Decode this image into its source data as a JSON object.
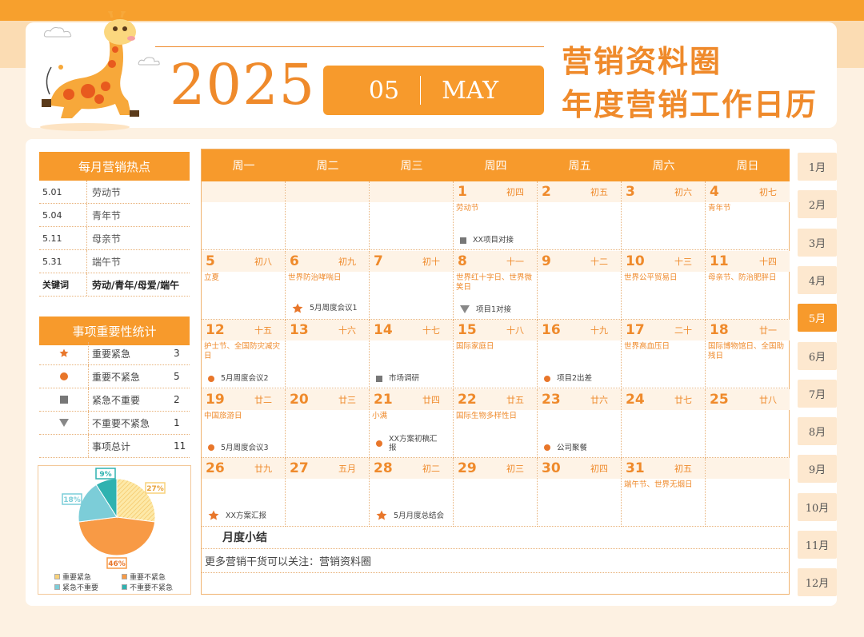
{
  "header": {
    "year": "2025",
    "month_num": "05",
    "month_en": "MAY",
    "brand": "营销资料圈",
    "subtitle": "年度营销工作日历"
  },
  "hotspots": {
    "title": "每月营销热点",
    "items": [
      {
        "date": "5.01",
        "name": "劳动节"
      },
      {
        "date": "5.04",
        "name": "青年节"
      },
      {
        "date": "5.11",
        "name": "母亲节"
      },
      {
        "date": "5.31",
        "name": "端午节"
      }
    ],
    "keyword_label": "关键词",
    "keywords": "劳动/青年/母爱/端午"
  },
  "stats": {
    "title": "事项重要性统计",
    "rows": [
      {
        "label": "重要紧急",
        "count": "3",
        "icon": "star-icon"
      },
      {
        "label": "重要不紧急",
        "count": "5",
        "icon": "circle-icon"
      },
      {
        "label": "紧急不重要",
        "count": "2",
        "icon": "square-icon"
      },
      {
        "label": "不重要不紧急",
        "count": "1",
        "icon": "triangle-icon"
      }
    ],
    "total_label": "事项总计",
    "total": "11"
  },
  "chart_data": {
    "type": "pie",
    "categories": [
      "重要紧急",
      "重要不紧急",
      "紧急不重要",
      "不重要不紧急"
    ],
    "values": [
      27,
      46,
      18,
      9
    ],
    "labels": [
      "27%",
      "46%",
      "18%",
      "9%"
    ],
    "colors": [
      "#f9d27a",
      "#f89a45",
      "#7ccdd8",
      "#2fb2b0"
    ],
    "legend": "bottom"
  },
  "calendar": {
    "weekdays": [
      "周一",
      "周二",
      "周三",
      "周四",
      "周五",
      "周六",
      "周日"
    ],
    "weeks": [
      [
        {
          "day": "",
          "lunar": "",
          "fest": "",
          "event": "",
          "icon": ""
        },
        {
          "day": "",
          "lunar": "",
          "fest": "",
          "event": "",
          "icon": ""
        },
        {
          "day": "",
          "lunar": "",
          "fest": "",
          "event": "",
          "icon": ""
        },
        {
          "day": "1",
          "lunar": "初四",
          "fest": "劳动节",
          "event": "XX项目对接",
          "icon": "square"
        },
        {
          "day": "2",
          "lunar": "初五",
          "fest": "",
          "event": "",
          "icon": ""
        },
        {
          "day": "3",
          "lunar": "初六",
          "fest": "",
          "event": "",
          "icon": ""
        },
        {
          "day": "4",
          "lunar": "初七",
          "fest": "青年节",
          "event": "",
          "icon": ""
        }
      ],
      [
        {
          "day": "5",
          "lunar": "初八",
          "fest": "立夏",
          "event": "",
          "icon": ""
        },
        {
          "day": "6",
          "lunar": "初九",
          "fest": "世界防治哮喘日",
          "event": "5月周度会议1",
          "icon": "star"
        },
        {
          "day": "7",
          "lunar": "初十",
          "fest": "",
          "event": "",
          "icon": ""
        },
        {
          "day": "8",
          "lunar": "十一",
          "fest": "世界红十字日、世界微笑日",
          "event": "项目1对接",
          "icon": "triangle"
        },
        {
          "day": "9",
          "lunar": "十二",
          "fest": "",
          "event": "",
          "icon": ""
        },
        {
          "day": "10",
          "lunar": "十三",
          "fest": "世界公平贸易日",
          "event": "",
          "icon": ""
        },
        {
          "day": "11",
          "lunar": "十四",
          "fest": "母亲节、防治肥胖日",
          "event": "",
          "icon": ""
        }
      ],
      [
        {
          "day": "12",
          "lunar": "十五",
          "fest": "护士节、全国防灾减灾日",
          "event": "5月周度会议2",
          "icon": "circle"
        },
        {
          "day": "13",
          "lunar": "十六",
          "fest": "",
          "event": "",
          "icon": ""
        },
        {
          "day": "14",
          "lunar": "十七",
          "fest": "",
          "event": "市场调研",
          "icon": "square"
        },
        {
          "day": "15",
          "lunar": "十八",
          "fest": "国际家庭日",
          "event": "",
          "icon": ""
        },
        {
          "day": "16",
          "lunar": "十九",
          "fest": "",
          "event": "项目2出差",
          "icon": "circle"
        },
        {
          "day": "17",
          "lunar": "二十",
          "fest": "世界高血压日",
          "event": "",
          "icon": ""
        },
        {
          "day": "18",
          "lunar": "廿一",
          "fest": "国际博物馆日、全国助残日",
          "event": "",
          "icon": ""
        }
      ],
      [
        {
          "day": "19",
          "lunar": "廿二",
          "fest": "中国旅游日",
          "event": "5月周度会议3",
          "icon": "circle"
        },
        {
          "day": "20",
          "lunar": "廿三",
          "fest": "",
          "event": "",
          "icon": ""
        },
        {
          "day": "21",
          "lunar": "廿四",
          "fest": "小满",
          "event": "XX方案初稿汇报",
          "icon": "circle"
        },
        {
          "day": "22",
          "lunar": "廿五",
          "fest": "国际生物多样性日",
          "event": "",
          "icon": ""
        },
        {
          "day": "23",
          "lunar": "廿六",
          "fest": "",
          "event": "公司聚餐",
          "icon": "circle"
        },
        {
          "day": "24",
          "lunar": "廿七",
          "fest": "",
          "event": "",
          "icon": ""
        },
        {
          "day": "25",
          "lunar": "廿八",
          "fest": "",
          "event": "",
          "icon": ""
        }
      ],
      [
        {
          "day": "26",
          "lunar": "廿九",
          "fest": "",
          "event": "XX方案汇报",
          "icon": "star"
        },
        {
          "day": "27",
          "lunar": "五月",
          "fest": "",
          "event": "",
          "icon": ""
        },
        {
          "day": "28",
          "lunar": "初二",
          "fest": "",
          "event": "5月月度总结会",
          "icon": "star"
        },
        {
          "day": "29",
          "lunar": "初三",
          "fest": "",
          "event": "",
          "icon": ""
        },
        {
          "day": "30",
          "lunar": "初四",
          "fest": "",
          "event": "",
          "icon": ""
        },
        {
          "day": "31",
          "lunar": "初五",
          "fest": "端午节、世界无烟日",
          "event": "",
          "icon": ""
        },
        {
          "day": "",
          "lunar": "",
          "fest": "",
          "event": "",
          "icon": ""
        }
      ]
    ],
    "summary_title": "月度小结",
    "summary_text": "更多营销干货可以关注：营销资料圈"
  },
  "months": [
    "1月",
    "2月",
    "3月",
    "4月",
    "5月",
    "6月",
    "7月",
    "8月",
    "9月",
    "10月",
    "11月",
    "12月"
  ],
  "active_month": 4,
  "colors": {
    "accent": "#f79a2c",
    "accent_text": "#ef8a2b",
    "tab_bg": "#fde8cf",
    "cell_head": "#fef3e6"
  }
}
